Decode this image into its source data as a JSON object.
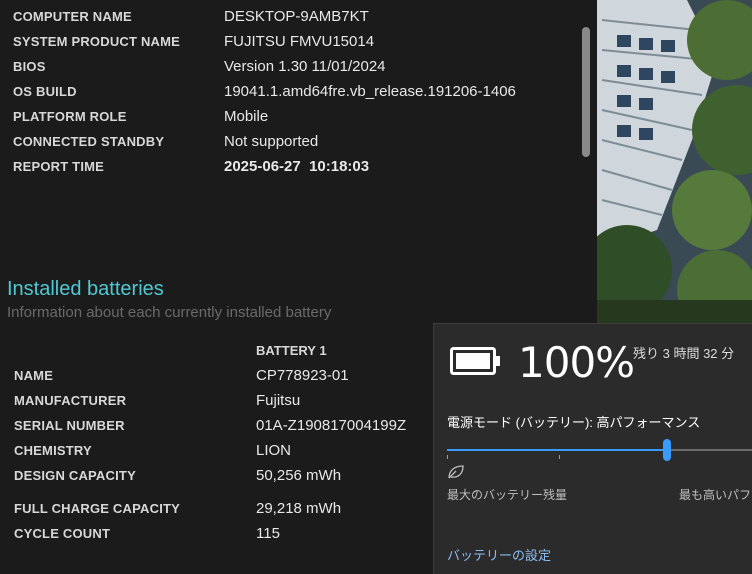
{
  "system_info": [
    {
      "label": "COMPUTER NAME",
      "value": "DESKTOP-9AMB7KT"
    },
    {
      "label": "SYSTEM PRODUCT NAME",
      "value": "FUJITSU FMVU15014"
    },
    {
      "label": "BIOS",
      "value": "Version 1.30 11/01/2024"
    },
    {
      "label": "OS BUILD",
      "value": "19041.1.amd64fre.vb_release.191206-1406"
    },
    {
      "label": "PLATFORM ROLE",
      "value": "Mobile"
    },
    {
      "label": "CONNECTED STANDBY",
      "value": "Not supported"
    },
    {
      "label": "REPORT TIME",
      "value": "2025-06-27  10:18:03"
    }
  ],
  "installed_batteries": {
    "title": "Installed batteries",
    "subtitle": "Information about each currently installed battery",
    "column_header": "BATTERY 1",
    "rows": [
      {
        "label": "NAME",
        "value": "CP778923-01"
      },
      {
        "label": "MANUFACTURER",
        "value": "Fujitsu"
      },
      {
        "label": "SERIAL NUMBER",
        "value": "01A-Z190817004199Z"
      },
      {
        "label": "CHEMISTRY",
        "value": "LION"
      },
      {
        "label": "DESIGN CAPACITY",
        "value": "50,256 mWh"
      },
      {
        "label": "FULL CHARGE CAPACITY",
        "value": "29,218 mWh"
      },
      {
        "label": "CYCLE COUNT",
        "value": "115"
      }
    ]
  },
  "battery_flyout": {
    "percent_text": "100%",
    "charge_fraction": 1.0,
    "time_remaining": "残り 3 時間 32 分",
    "power_mode_label": "電源モード (バッテリー): 高パフォーマンス",
    "slider_position_fraction": 0.72,
    "slider_min_label": "最大のバッテリー残量",
    "slider_max_label": "最も高いパフォー",
    "settings_link": "バッテリーの設定",
    "accent_color": "#3a9bff",
    "icons": [
      "battery-icon",
      "leaf-icon"
    ]
  },
  "colors": {
    "section_title": "#4fc9d4",
    "background": "#1b1b1b",
    "flyout_background": "#2b2b2b"
  }
}
